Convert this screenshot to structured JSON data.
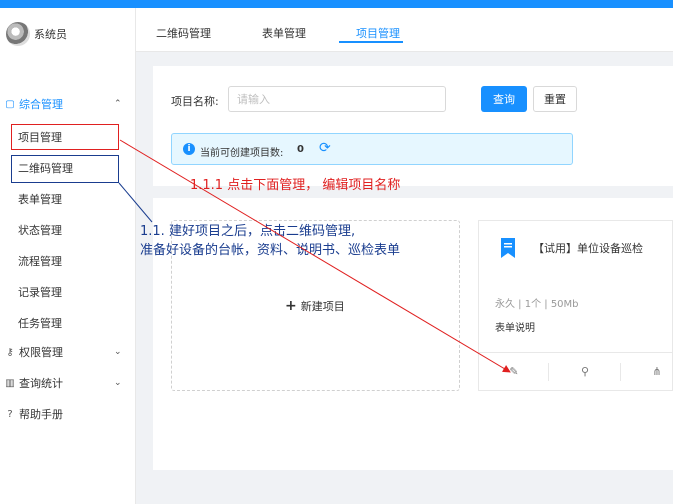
{
  "user": {
    "name": "系统员"
  },
  "sidebar": {
    "groups": [
      {
        "label": "综合管理"
      },
      {
        "label": "权限管理"
      },
      {
        "label": "查询统计"
      },
      {
        "label": "帮助手册"
      }
    ],
    "items": [
      {
        "label": "项目管理"
      },
      {
        "label": "二维码管理"
      },
      {
        "label": "表单管理"
      },
      {
        "label": "状态管理"
      },
      {
        "label": "流程管理"
      },
      {
        "label": "记录管理"
      },
      {
        "label": "任务管理"
      }
    ]
  },
  "tabs": [
    {
      "label": "二维码管理"
    },
    {
      "label": "表单管理"
    },
    {
      "label": "项目管理",
      "active": true
    }
  ],
  "filter": {
    "label": "项目名称:",
    "placeholder": "请输入",
    "search_label": "查询",
    "reset_label": "重置"
  },
  "alert": {
    "text": "当前可创建项目数:",
    "count": "0"
  },
  "new_project": {
    "label": "新建项目"
  },
  "project_card": {
    "title": "【试用】单位设备巡检",
    "meta": "永久 | 1个 | 50Mb",
    "description": "表单说明"
  },
  "annotations": {
    "red": "1.1.1 点击下面管理， 编辑项目名称",
    "blue_line1": "1.1. 建好项目之后，点击二维码管理,",
    "blue_line2": "准备好设备的台帐，资料、说明书、巡检表单"
  },
  "colors": {
    "primary": "#1890ff",
    "annotation_red": "#e02020",
    "annotation_blue": "#1a3d8f"
  }
}
